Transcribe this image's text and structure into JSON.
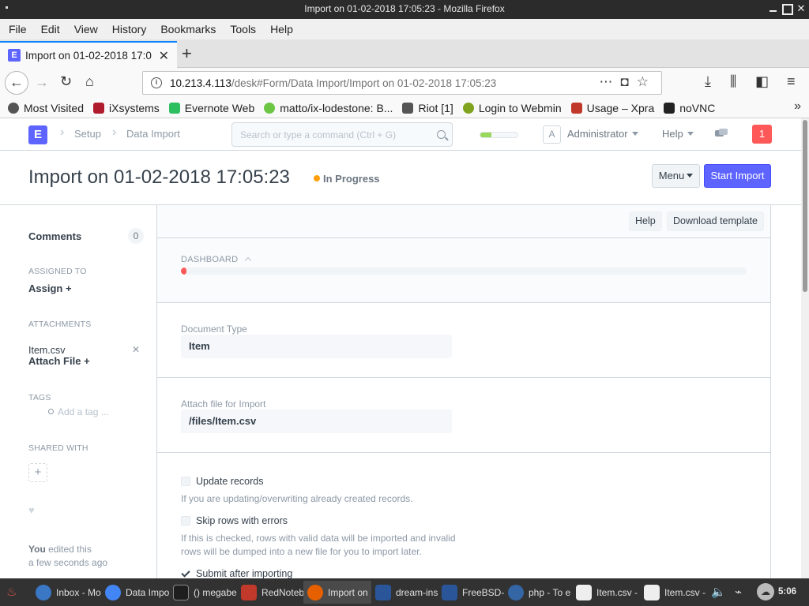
{
  "window": {
    "title": "Import on 01-02-2018 17:05:23 - Mozilla Firefox"
  },
  "menubar": [
    "File",
    "Edit",
    "View",
    "History",
    "Bookmarks",
    "Tools",
    "Help"
  ],
  "tab": {
    "title": "Import on 01-02-2018 17:0",
    "favicon": "E"
  },
  "url": {
    "host": "10.213.4.113",
    "path": "/desk#Form/Data Import/Import on 01-02-2018 17:05:23"
  },
  "bookmarks": [
    {
      "label": "Most Visited",
      "color": "#444444"
    },
    {
      "label": "iXsystems",
      "color": "#b01c2e"
    },
    {
      "label": "Evernote Web",
      "color": "#2dbe60"
    },
    {
      "label": "matto/ix-lodestone: B...",
      "color": "#6cc644"
    },
    {
      "label": "Riot [1]",
      "color": "#555555"
    },
    {
      "label": "Login to Webmin",
      "color": "#7fa31c"
    },
    {
      "label": "Usage – Xpra",
      "color": "#c0392b"
    },
    {
      "label": "noVNC",
      "color": "#222222"
    }
  ],
  "app": {
    "logo": "E",
    "breadcrumbs": [
      "Setup",
      "Data Import"
    ],
    "search_placeholder": "Search or type a command (Ctrl + G)",
    "sync_progress": 0.3,
    "avatar": "A",
    "user": "Administrator",
    "help": "Help",
    "notifications": "1"
  },
  "doc": {
    "title": "Import on 01-02-2018 17:05:23",
    "status": "In Progress",
    "status_color": "#ffa00a",
    "menu_label": "Menu",
    "primary_label": "Start Import"
  },
  "sidebar": {
    "comments_label": "Comments",
    "comments_count": "0",
    "assigned_to_label": "ASSIGNED TO",
    "assign_label": "Assign +",
    "attachments_label": "ATTACHMENTS",
    "attachment_file": "Item.csv",
    "attach_file_label": "Attach File +",
    "tags_label": "TAGS",
    "add_tag_placeholder": "Add a tag ...",
    "shared_with_label": "SHARED WITH",
    "edit_user": "You",
    "edit_action": "edited this",
    "edit_time": "a few seconds ago"
  },
  "form": {
    "help_button": "Help",
    "download_button": "Download template",
    "dashboard_label": "DASHBOARD",
    "dashboard_progress": 0.01,
    "document_type_label": "Document Type",
    "document_type_value": "Item",
    "attach_label": "Attach file for Import",
    "attach_value": "/files/Item.csv",
    "update_records_label": "Update records",
    "update_records_desc": "If you are updating/overwriting already created records.",
    "skip_rows_label": "Skip rows with errors",
    "skip_rows_desc": "If this is checked, rows with valid data will be imported and invalid rows will be dumped into a new file for you to import later.",
    "submit_label": "Submit after importing"
  },
  "taskbar": {
    "tasks": [
      {
        "label": "Inbox - Mo",
        "color": "#3a77c4"
      },
      {
        "label": "Data Impo",
        "color": "#4285f4"
      },
      {
        "label": "() megabe",
        "color": "#1e1e1e"
      },
      {
        "label": "RedNoteb",
        "color": "#c0392b"
      },
      {
        "label": "Import on",
        "color": "#e66000"
      },
      {
        "label": "dream-ins",
        "color": "#2a5699"
      },
      {
        "label": "FreeBSD-E",
        "color": "#2a5699"
      },
      {
        "label": "php - To e",
        "color": "#3465a4"
      },
      {
        "label": "Item.csv -",
        "color": "#eeeeee"
      },
      {
        "label": "Item.csv -",
        "color": "#eeeeee"
      }
    ],
    "clock": "5:06 PM"
  }
}
